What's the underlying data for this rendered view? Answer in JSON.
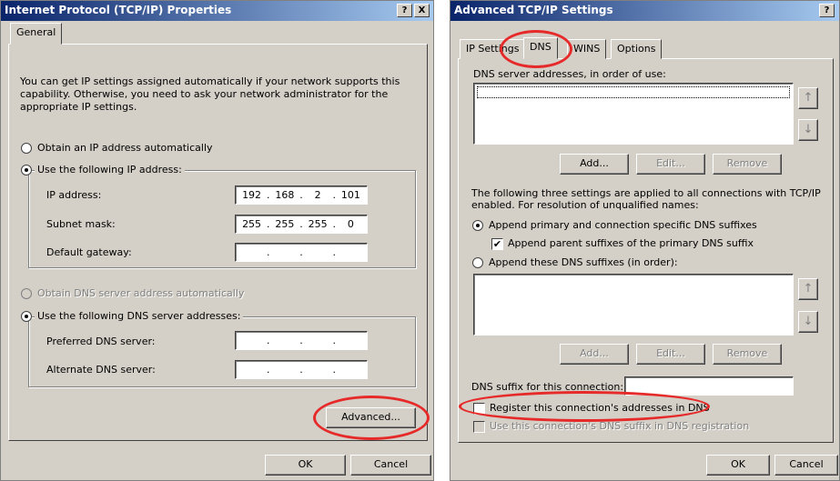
{
  "left": {
    "title": "Internet Protocol (TCP/IP) Properties",
    "help_btn": "?",
    "close_btn": "X",
    "tab_general": "General",
    "intro": "You can get IP settings assigned automatically if your network supports this capability. Otherwise, you need to ask your network administrator for the appropriate IP settings.",
    "obtain_ip_auto": "Obtain an IP address automatically",
    "use_following_ip": "Use the following IP address:",
    "ip_address_label": "IP address:",
    "ip_address": [
      "192",
      "168",
      "2",
      "101"
    ],
    "subnet_label": "Subnet mask:",
    "subnet": [
      "255",
      "255",
      "255",
      "0"
    ],
    "gateway_label": "Default gateway:",
    "gateway": [
      "",
      "",
      "",
      ""
    ],
    "obtain_dns_auto": "Obtain DNS server address automatically",
    "use_following_dns": "Use the following DNS server addresses:",
    "preferred_dns_label": "Preferred DNS server:",
    "preferred_dns": [
      "",
      "",
      "",
      ""
    ],
    "alternate_dns_label": "Alternate DNS server:",
    "alternate_dns": [
      "",
      "",
      "",
      ""
    ],
    "advanced_btn": "Advanced...",
    "ok_btn": "OK",
    "cancel_btn": "Cancel"
  },
  "right": {
    "title": "Advanced TCP/IP Settings",
    "help_btn": "?",
    "close_btn": "X",
    "tabs": [
      "IP Settings",
      "DNS",
      "WINS",
      "Options"
    ],
    "dns_list_label": "DNS server addresses, in order of use:",
    "add_btn": "Add...",
    "edit_btn": "Edit...",
    "remove_btn": "Remove",
    "add_btn2": "Add...",
    "edit_btn2": "Edit...",
    "remove_btn2": "Remove",
    "info_text": "The following three settings are applied to all connections with TCP/IP enabled. For resolution of unqualified names:",
    "append_primary": "Append primary and connection specific DNS suffixes",
    "append_parent": "Append parent suffixes of the primary DNS suffix",
    "append_these": "Append these DNS suffixes (in order):",
    "dns_suffix_label": "DNS suffix for this connection:",
    "dns_suffix_value": "",
    "register_addresses": "Register this connection's addresses in DNS",
    "use_suffix_registration": "Use this connection's DNS suffix in DNS registration",
    "ok_btn": "OK",
    "cancel_btn": "Cancel",
    "up_arrow": "↑",
    "down_arrow": "↓"
  }
}
